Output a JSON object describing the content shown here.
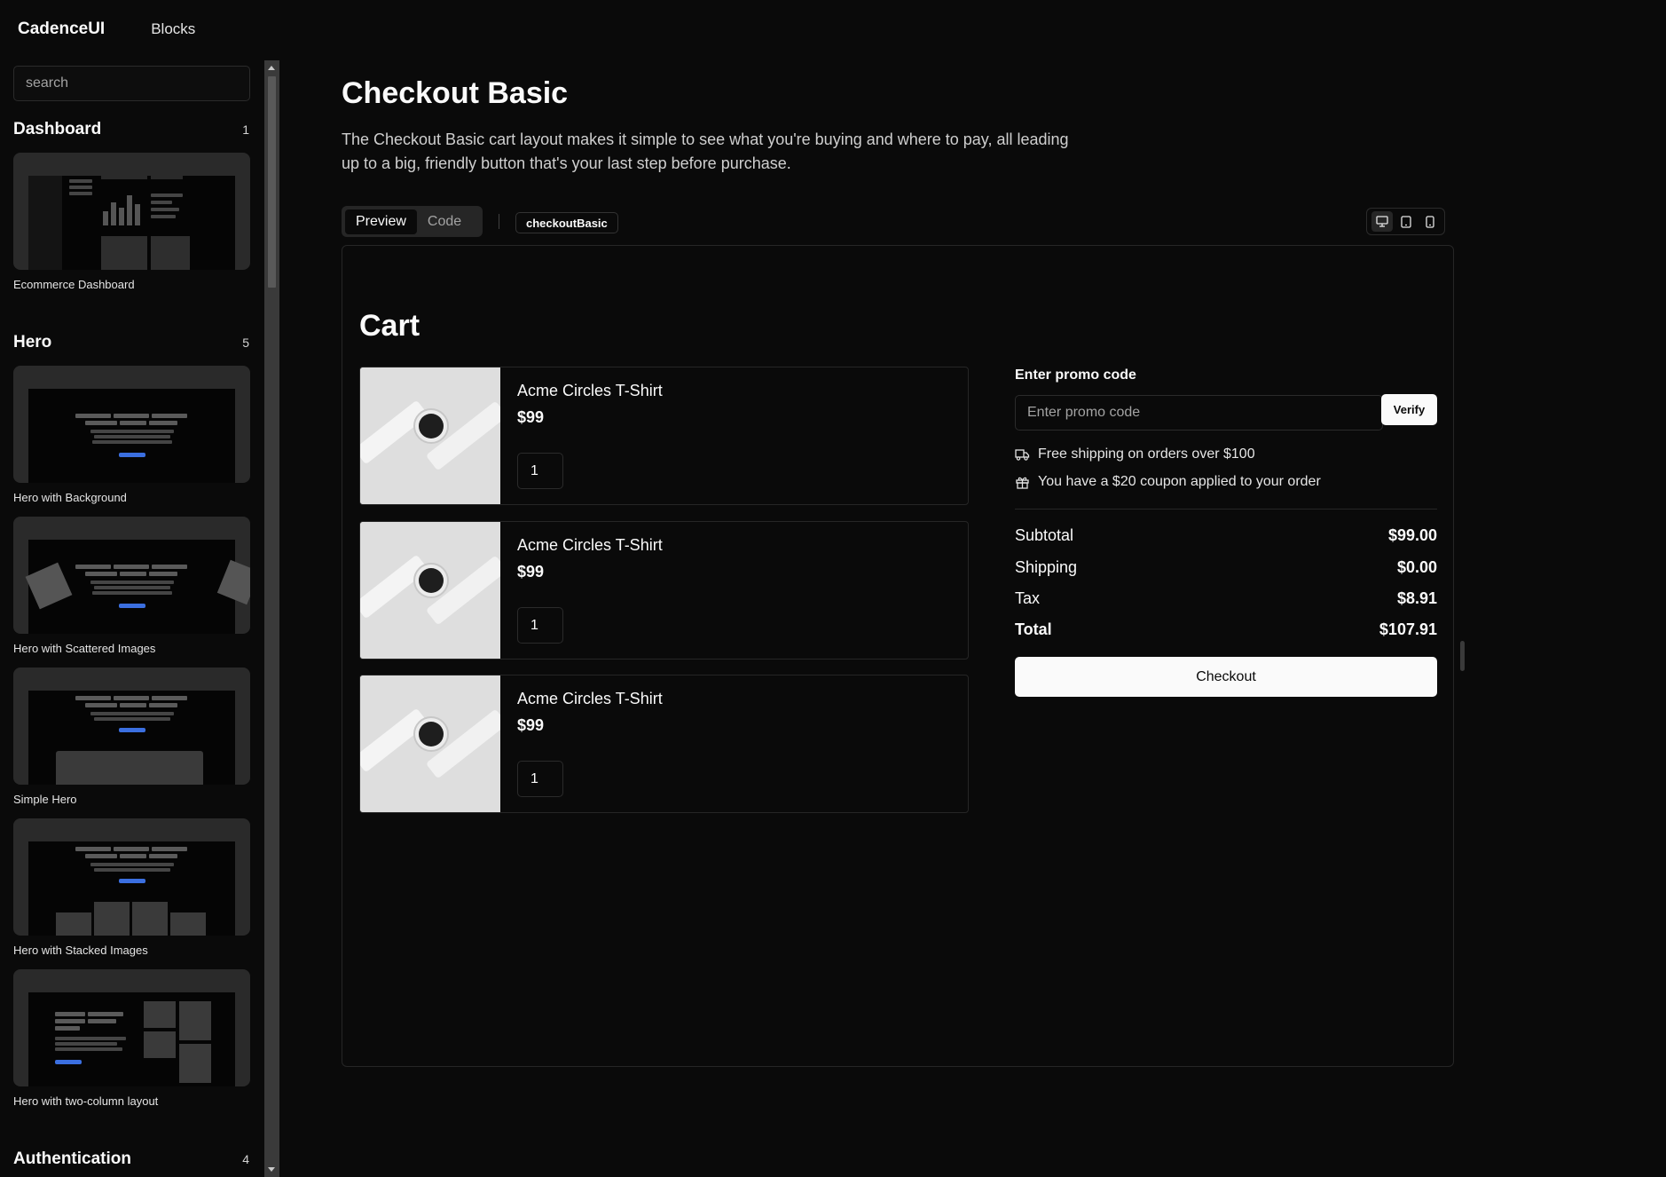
{
  "app": {
    "brand": "CadenceUI",
    "nav_link": "Blocks"
  },
  "sidebar": {
    "search_placeholder": "search",
    "sections": [
      {
        "title": "Dashboard",
        "count": "1",
        "blocks": [
          "Ecommerce Dashboard"
        ]
      },
      {
        "title": "Hero",
        "count": "5",
        "blocks": [
          "Hero with Background",
          "Hero with Scattered Images",
          "Simple Hero",
          "Hero with Stacked Images",
          "Hero with two-column layout"
        ]
      },
      {
        "title": "Authentication",
        "count": "4",
        "blocks": []
      }
    ]
  },
  "main": {
    "title": "Checkout Basic",
    "description": "The Checkout Basic cart layout makes it simple to see what you're buying and where to pay, all leading up to a big, friendly button that's your last step before purchase.",
    "tabs": [
      {
        "label": "Preview",
        "active": true
      },
      {
        "label": "Code",
        "active": false
      }
    ],
    "block_id": "checkoutBasic",
    "device_icons": [
      "desktop-icon",
      "tablet-icon",
      "mobile-icon"
    ]
  },
  "cart": {
    "title": "Cart",
    "items": [
      {
        "name": "Acme Circles T-Shirt",
        "price": "$99",
        "qty": "1"
      },
      {
        "name": "Acme Circles T-Shirt",
        "price": "$99",
        "qty": "1"
      },
      {
        "name": "Acme Circles T-Shirt",
        "price": "$99",
        "qty": "1"
      }
    ],
    "promo": {
      "label": "Enter promo code",
      "placeholder": "Enter promo code",
      "verify_label": "Verify"
    },
    "perks": [
      {
        "icon": "truck-icon",
        "text": "Free shipping on orders over $100"
      },
      {
        "icon": "gift-icon",
        "text": "You have a $20 coupon applied to your order"
      }
    ],
    "summary": [
      {
        "label": "Subtotal",
        "value": "$99.00"
      },
      {
        "label": "Shipping",
        "value": "$0.00"
      },
      {
        "label": "Tax",
        "value": "$8.91"
      },
      {
        "label": "Total",
        "value": "$107.91"
      }
    ],
    "checkout_label": "Checkout"
  },
  "colors": {
    "background": "#0a0a0a",
    "border": "#262626",
    "accent": "#3b6fe0",
    "button": "#fafafa"
  }
}
